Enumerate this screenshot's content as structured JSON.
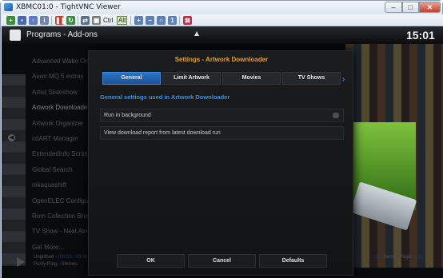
{
  "window": {
    "title": "XBMC01:0 - TightVNC Viewer",
    "minimize": "–",
    "maximize": "□",
    "close": "✕"
  },
  "toolbar": {
    "ctrl_label": "Ctrl",
    "alt_label": "Alt"
  },
  "xbmc": {
    "breadcrumb": "Programs  -  Add-ons",
    "clock": "15:01",
    "list": [
      "Advanced Wake On",
      "Aeon MQ 5 extras",
      "Artist Slideshow",
      "Artwork Downloader",
      "Artwork Organizer",
      "cdART Manager",
      "ExtendedInfo Script",
      "Global Search",
      "mkaquashift",
      "OpenELEC Configur",
      "Rom Collection Brow",
      "TV Show - Next Aire",
      "Get More..."
    ],
    "now_playing": {
      "line1_prefix": "Unglithed - ",
      "line1_time": "(00:20 / 02:48)",
      "line2": "Purity Ring - Shrines"
    },
    "items": {
      "count": "(11)",
      "items_label": " Items - Page ",
      "page": "(1/1)"
    }
  },
  "dialog": {
    "title": "Settings - Artwork Downloader",
    "tabs": [
      "General",
      "Limit Artwork",
      "Movies",
      "TV Shows"
    ],
    "active_tab": "General",
    "section_title": "General settings used in Artwork Downloader",
    "rows": [
      "Run in background",
      "View download report from latest download run"
    ],
    "buttons": {
      "ok": "OK",
      "cancel": "Cancel",
      "defaults": "Defaults"
    }
  },
  "colors": {
    "accent_orange": "#e89c2a",
    "accent_blue": "#3d8ee0",
    "active_tab": "#2d73c2"
  }
}
